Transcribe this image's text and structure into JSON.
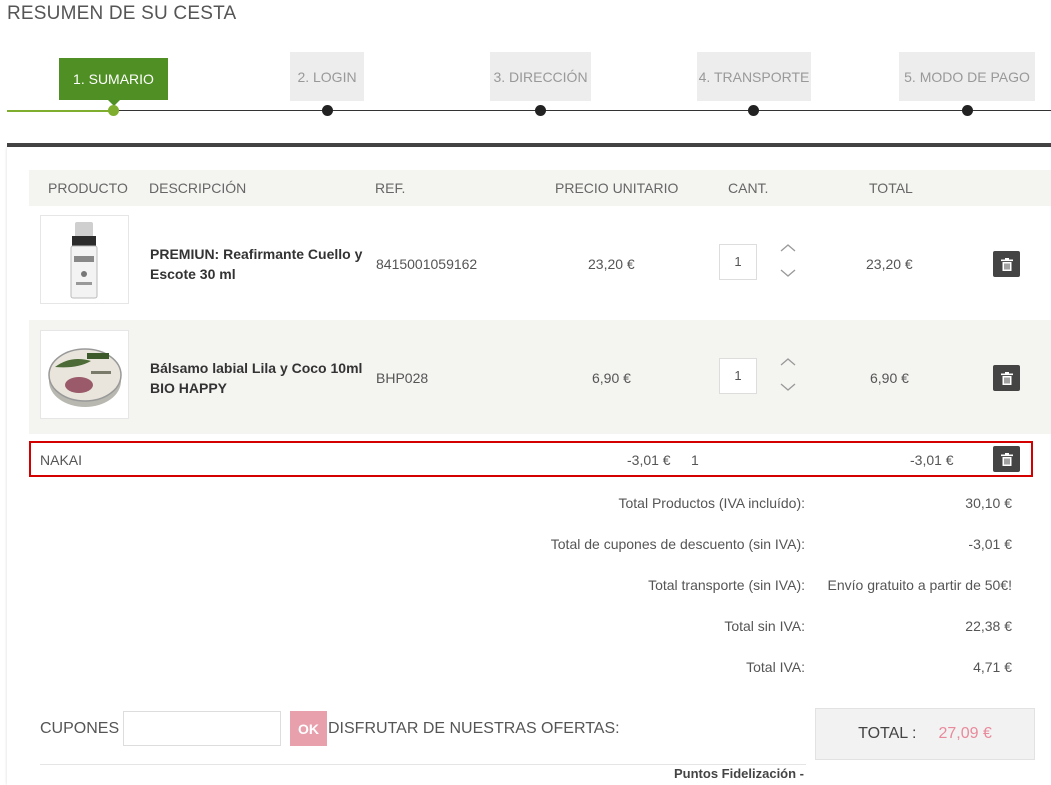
{
  "page": {
    "title": "RESUMEN DE SU CESTA"
  },
  "steps": [
    {
      "label": "1. SUMARIO",
      "active": true
    },
    {
      "label": "2. LOGIN",
      "active": false
    },
    {
      "label": "3. DIRECCIÓN",
      "active": false
    },
    {
      "label": "4. TRANSPORTE",
      "active": false
    },
    {
      "label": "5. MODO DE PAGO",
      "active": false
    }
  ],
  "table": {
    "headers": {
      "product": "PRODUCTO",
      "description": "DESCRIPCIÓN",
      "ref": "REF.",
      "unit_price": "PRECIO UNITARIO",
      "qty": "CANT.",
      "total": "TOTAL"
    },
    "rows": [
      {
        "description_line1": "PREMIUN: Reafirmante Cuello y",
        "description_line2": "Escote 30 ml",
        "ref": "8415001059162",
        "unit_price": "23,20 €",
        "qty": "1",
        "total": "23,20 €"
      },
      {
        "description_line1": "Bálsamo labial Lila y Coco 10ml",
        "description_line2": "BIO HAPPY",
        "ref": "BHP028",
        "unit_price": "6,90 €",
        "qty": "1",
        "total": "6,90 €"
      }
    ],
    "discount": {
      "name": "NAKAI",
      "unit_price": "-3,01 €",
      "qty": "1",
      "total": "-3,01 €"
    }
  },
  "totals": [
    {
      "label": "Total Productos (IVA incluído):",
      "value": "30,10 €"
    },
    {
      "label": "Total de cupones de descuento (sin IVA):",
      "value": "-3,01 €"
    },
    {
      "label": "Total transporte (sin IVA):",
      "value": "Envío gratuito a partir de 50€!"
    },
    {
      "label": "Total sin IVA:",
      "value": "22,38 €"
    },
    {
      "label": "Total IVA:",
      "value": "4,71 €"
    }
  ],
  "coupons": {
    "label": "CUPONES",
    "input_value": "",
    "ok_label": "OK",
    "offers_label": "DISFRUTAR DE NUESTRAS OFERTAS:"
  },
  "grand_total": {
    "label": "TOTAL :",
    "value": "27,09 €"
  },
  "points": {
    "label": "Puntos Fidelización -"
  },
  "colors": {
    "active_step": "#4f8f24",
    "accent_green": "#7fae2e",
    "highlight_border": "#d40000",
    "total_value": "#e88a9c",
    "ok_button": "#e8a0ad"
  }
}
